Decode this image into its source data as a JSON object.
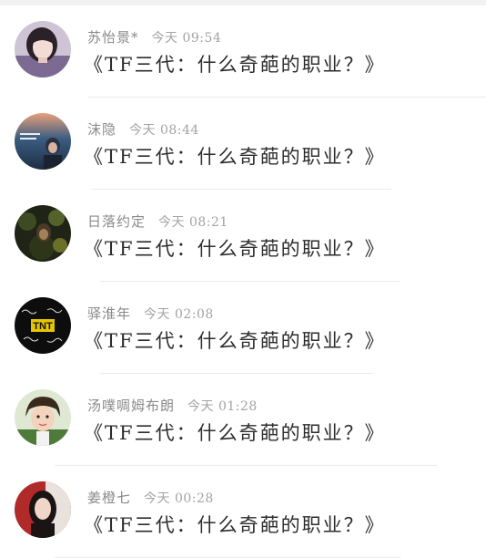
{
  "messages": [
    {
      "name": "苏怡景*",
      "time": "今天 09:54",
      "text": "《TF三代：什么奇葩的职业？》",
      "avatar_icon": "girl-purple-avatar"
    },
    {
      "name": "沫隐",
      "time": "今天 08:44",
      "text": "《TF三代：什么奇葩的职业？》",
      "avatar_icon": "poster-blue-avatar"
    },
    {
      "name": "日落约定",
      "time": "今天 08:21",
      "text": "《TF三代：什么奇葩的职业？》",
      "avatar_icon": "dark-foliage-avatar"
    },
    {
      "name": "驿淮年",
      "time": "今天 02:08",
      "text": "《TF三代：什么奇葩的职业？》",
      "avatar_icon": "tnt-logo-avatar"
    },
    {
      "name": "汤噗啁姆布朗",
      "time": "今天 01:28",
      "text": "《TF三代：什么奇葩的职业？》",
      "avatar_icon": "boy-cartoon-avatar"
    },
    {
      "name": "姜橙七",
      "time": "今天 00:28",
      "text": "《TF三代：什么奇葩的职业？》",
      "avatar_icon": "girl-red-avatar"
    }
  ],
  "avatar_logo_text": "TNT",
  "colors": {
    "name": "#8a8a8a",
    "time": "#a3a3a3",
    "message": "#2d2d2d",
    "divider": "#ebebeb"
  }
}
